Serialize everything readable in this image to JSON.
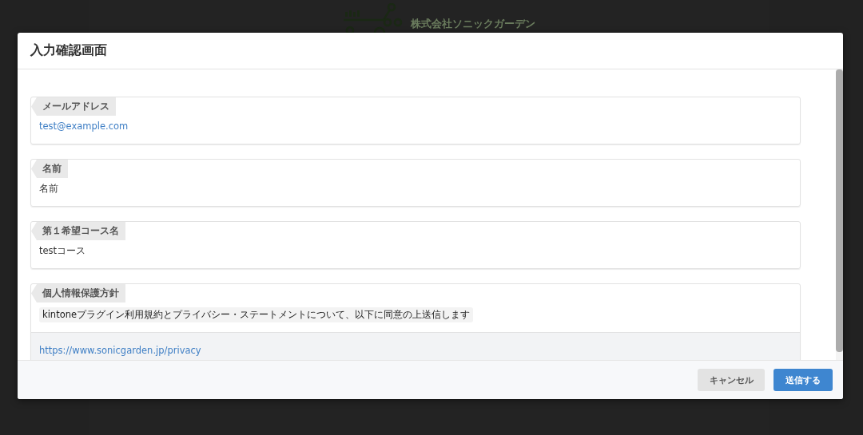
{
  "background": {
    "company_name": "株式会社ソニックガーデン"
  },
  "dialog": {
    "title": "入力確認画面",
    "fields": [
      {
        "kind": "link",
        "label": "メールアドレス",
        "value": "test@example.com"
      },
      {
        "kind": "text",
        "label": "名前",
        "value": "名前"
      },
      {
        "kind": "text",
        "label": "第１希望コース名",
        "value": "testコース"
      },
      {
        "kind": "consent",
        "label": "個人情報保護方針",
        "value": "kintoneプラグイン利用規約とプライバシー・ステートメントについて、以下に同意の上送信します",
        "link": "https://www.sonicgarden.jp/privacy"
      }
    ],
    "buttons": [
      {
        "kind": "secondary",
        "label": "キャンセル"
      },
      {
        "kind": "primary",
        "label": "送信する"
      }
    ]
  }
}
